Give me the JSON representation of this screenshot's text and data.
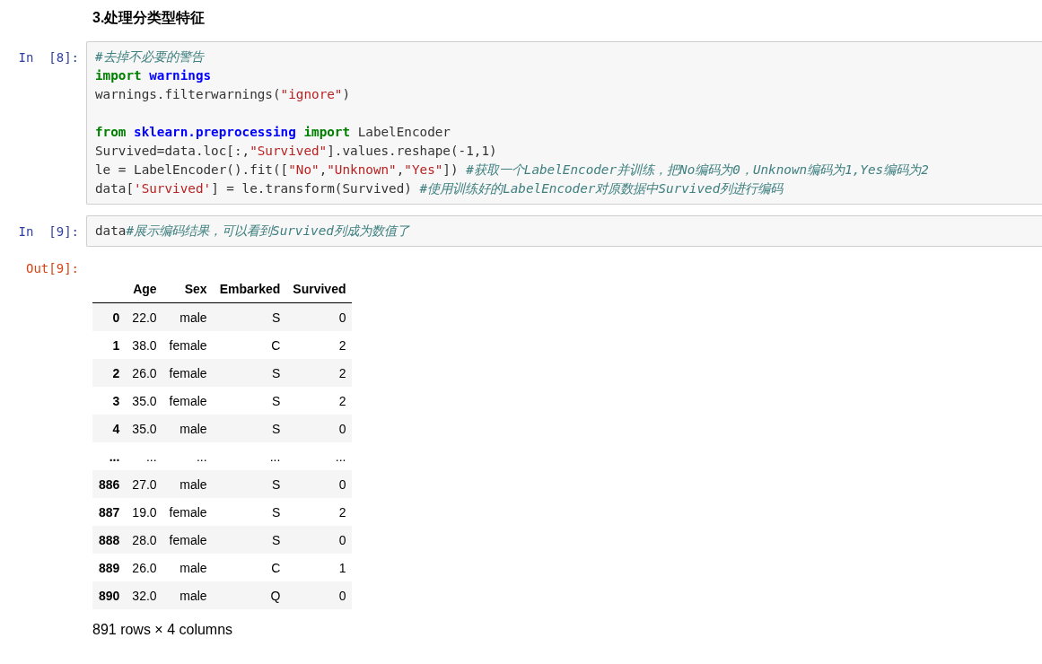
{
  "heading": "3.处理分类型特征",
  "cells": [
    {
      "kind": "input",
      "prompt": "In  [8]:",
      "lines": [
        {
          "kind": "code",
          "tokens": [
            {
              "kind": "comment",
              "text": "#去掉不必要的警告"
            }
          ]
        },
        {
          "kind": "code",
          "tokens": [
            {
              "kind": "kw",
              "text": "import "
            },
            {
              "kind": "module",
              "text": "warnings"
            }
          ]
        },
        {
          "kind": "code",
          "tokens": [
            {
              "kind": "plain",
              "text": "warnings.filterwarnings("
            },
            {
              "kind": "str",
              "text": "\"ignore\""
            },
            {
              "kind": "plain",
              "text": ")"
            }
          ]
        },
        {
          "kind": "blank"
        },
        {
          "kind": "code",
          "tokens": [
            {
              "kind": "kw",
              "text": "from "
            },
            {
              "kind": "module",
              "text": "sklearn.preprocessing "
            },
            {
              "kind": "kw",
              "text": "import"
            },
            {
              "kind": "plain",
              "text": " LabelEncoder"
            }
          ]
        },
        {
          "kind": "code",
          "tokens": [
            {
              "kind": "plain",
              "text": "Survived=data.loc[:,"
            },
            {
              "kind": "str",
              "text": "\"Survived\""
            },
            {
              "kind": "plain",
              "text": "].values.reshape(-1,1)"
            }
          ]
        },
        {
          "kind": "code",
          "tokens": [
            {
              "kind": "plain",
              "text": "le = LabelEncoder().fit(["
            },
            {
              "kind": "str",
              "text": "\"No\""
            },
            {
              "kind": "plain",
              "text": ","
            },
            {
              "kind": "str",
              "text": "\"Unknown\""
            },
            {
              "kind": "plain",
              "text": ","
            },
            {
              "kind": "str",
              "text": "\"Yes\""
            },
            {
              "kind": "plain",
              "text": "]) "
            },
            {
              "kind": "comment",
              "text": "#获取一个LabelEncoder并训练，把No编码为0，Unknown编码为1,Yes编码为2"
            }
          ]
        },
        {
          "kind": "code",
          "tokens": [
            {
              "kind": "plain",
              "text": "data["
            },
            {
              "kind": "str",
              "text": "'Survived'"
            },
            {
              "kind": "plain",
              "text": "] = le.transform(Survived) "
            },
            {
              "kind": "comment",
              "text": "#使用训练好的LabelEncoder对原数据中Survived列进行编码"
            }
          ]
        }
      ]
    },
    {
      "kind": "input",
      "prompt": "In  [9]:",
      "lines": [
        {
          "kind": "code",
          "tokens": [
            {
              "kind": "plain",
              "text": "data"
            },
            {
              "kind": "comment",
              "text": "#展示编码结果，可以看到Survived列成为数值了"
            }
          ]
        }
      ]
    },
    {
      "kind": "output",
      "prompt": "Out[9]:",
      "table": {
        "columns": [
          "Age",
          "Sex",
          "Embarked",
          "Survived"
        ],
        "rows": [
          {
            "index": "0",
            "cells": [
              "22.0",
              "male",
              "S",
              "0"
            ]
          },
          {
            "index": "1",
            "cells": [
              "38.0",
              "female",
              "C",
              "2"
            ]
          },
          {
            "index": "2",
            "cells": [
              "26.0",
              "female",
              "S",
              "2"
            ]
          },
          {
            "index": "3",
            "cells": [
              "35.0",
              "female",
              "S",
              "2"
            ]
          },
          {
            "index": "4",
            "cells": [
              "35.0",
              "male",
              "S",
              "0"
            ]
          },
          {
            "index": "...",
            "cells": [
              "...",
              "...",
              "...",
              "..."
            ]
          },
          {
            "index": "886",
            "cells": [
              "27.0",
              "male",
              "S",
              "0"
            ]
          },
          {
            "index": "887",
            "cells": [
              "19.0",
              "female",
              "S",
              "2"
            ]
          },
          {
            "index": "888",
            "cells": [
              "28.0",
              "female",
              "S",
              "0"
            ]
          },
          {
            "index": "889",
            "cells": [
              "26.0",
              "male",
              "C",
              "1"
            ]
          },
          {
            "index": "890",
            "cells": [
              "32.0",
              "male",
              "Q",
              "0"
            ]
          }
        ],
        "summary": "891 rows × 4 columns"
      }
    }
  ]
}
